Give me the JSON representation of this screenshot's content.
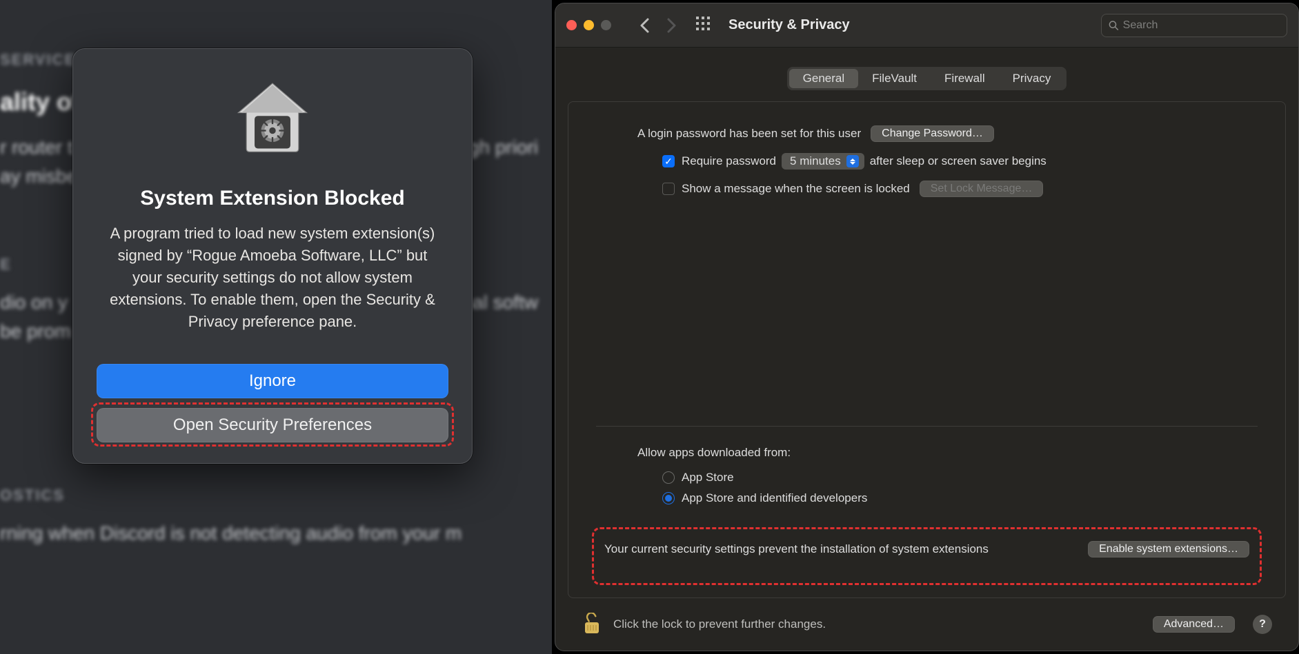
{
  "left": {
    "bg": {
      "section1": "SERVICE",
      "heading1": "ality of S",
      "line1a": "r router t",
      "line1b": "gh priori",
      "line2a": "ay misbe",
      "section2": "E",
      "line3a": "dio on y",
      "line3b": "nal softw",
      "line4a": "be prom",
      "section3": "OSTICS",
      "line5": "rning when Discord is not detecting audio from your m"
    },
    "dialog": {
      "title": "System Extension Blocked",
      "message": "A program tried to load new system extension(s) signed by “Rogue Amoeba Software, LLC” but your security settings do not allow system extensions. To enable them, open the Security & Privacy preference pane.",
      "ignore": "Ignore",
      "open": "Open Security Preferences"
    }
  },
  "right": {
    "title": "Security & Privacy",
    "search_placeholder": "Search",
    "tabs": {
      "general": "General",
      "filevault": "FileVault",
      "firewall": "Firewall",
      "privacy": "Privacy"
    },
    "password_set": "A login password has been set for this user",
    "change_pw": "Change Password…",
    "require_pw": "Require password",
    "delay": "5 minutes",
    "after_sleep": "after sleep or screen saver begins",
    "show_msg": "Show a message when the screen is locked",
    "set_lock_msg": "Set Lock Message…",
    "allow_from": "Allow apps downloaded from:",
    "appstore": "App Store",
    "appstore_dev": "App Store and identified developers",
    "ext_msg": "Your current security settings prevent the installation of system extensions",
    "enable_ext": "Enable system extensions…",
    "lock_text": "Click the lock to prevent further changes.",
    "advanced": "Advanced…"
  }
}
